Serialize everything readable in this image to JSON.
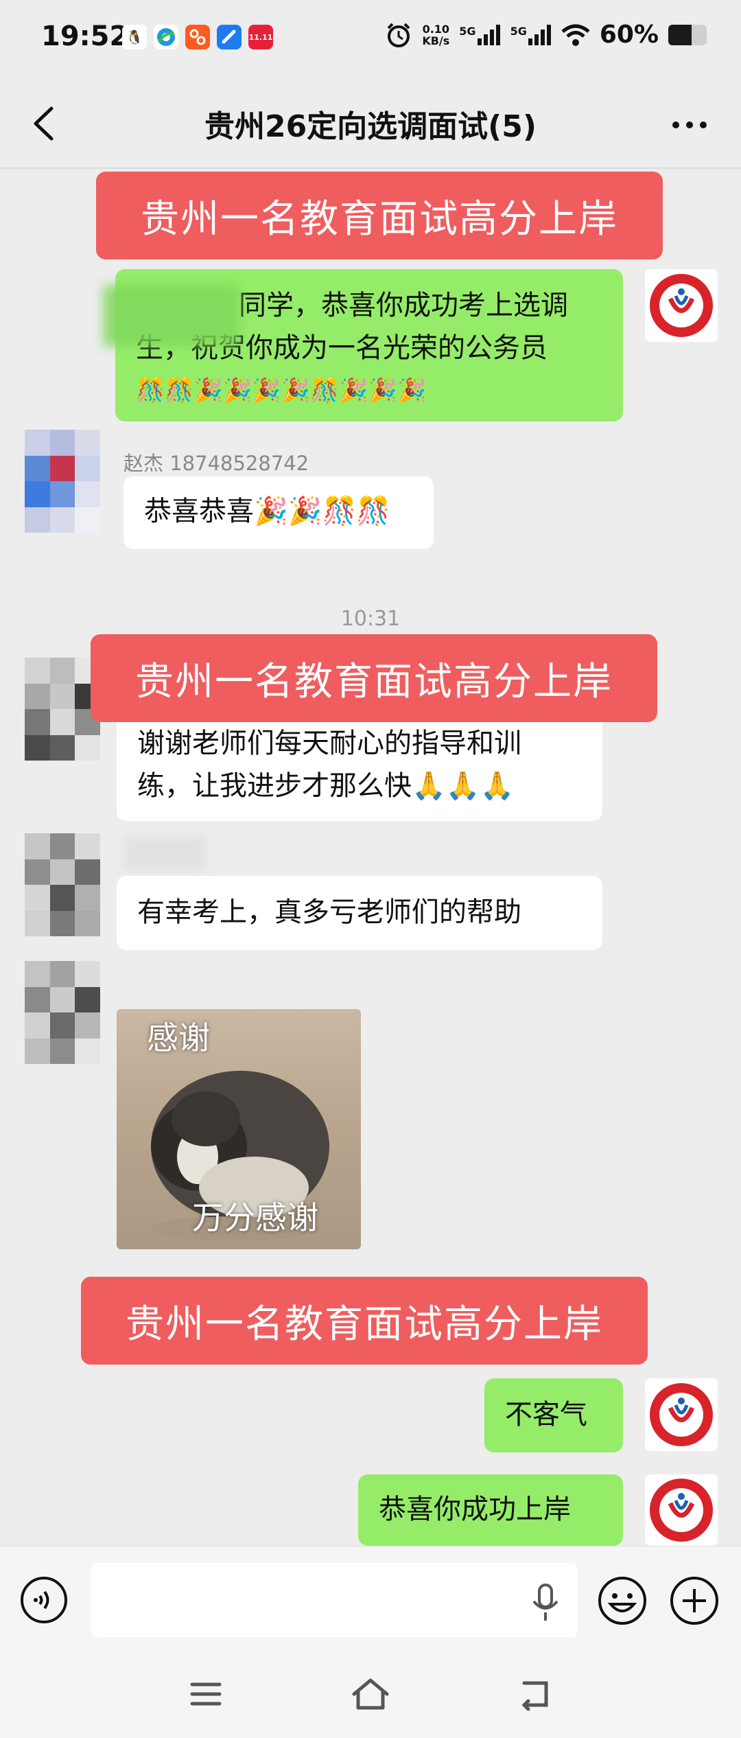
{
  "status_bar": {
    "time": "19:52",
    "speed_value": "0.10",
    "speed_unit": "KB/s",
    "net1": "5G",
    "net2": "5G",
    "battery": "60%",
    "battery_level": 0.6,
    "app_icons": [
      "qq-icon",
      "browser-icon",
      "taobao-icon",
      "note-icon",
      "shopping-icon"
    ],
    "shop_badge": "11.11"
  },
  "header": {
    "title": "贵州26定向选调面试(5)"
  },
  "banner_text": "贵州一名教育面试高分上岸",
  "messages": {
    "m1_line1": "同学，恭喜你成功考上选调",
    "m1_line2": "生，祝贺你成为一名光荣的公务员",
    "m1_line3": "🎊🎊🎉🎉🎉🎉🎊🎉🎉🎉",
    "m2_sender": "赵杰  18748528742",
    "m2_text": "恭喜恭喜🎉🎉🎊🎊",
    "time_sep": "10:31",
    "m3_line1": "谢谢老师们每天耐心的指导和训",
    "m3_line2": "练，让我进步才那么快🙏🙏🙏",
    "m4_text": "有幸考上，真多亏老师们的帮助",
    "img_cap_top": "感谢",
    "img_cap_bottom": "万分感谢",
    "m5_text": "不客气",
    "m6_text": "恭喜你成功上岸"
  },
  "colors": {
    "banner": "#ef5d5f",
    "bubble_self": "#95ec69",
    "bubble_other": "#ffffff",
    "logo_red": "#d8232a"
  }
}
